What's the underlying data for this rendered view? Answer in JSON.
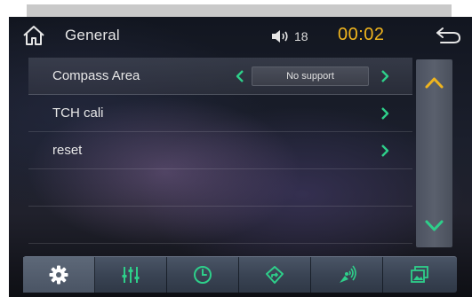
{
  "header": {
    "title": "General",
    "volume_level": "18",
    "time": "00:02"
  },
  "settings": {
    "items": [
      {
        "label": "Compass Area",
        "value": "No support"
      },
      {
        "label": "TCH cali"
      },
      {
        "label": "reset"
      }
    ]
  },
  "colors": {
    "accent": "#f0b51e",
    "text": "#e8e8e8",
    "chevron": "#2ecf8a"
  },
  "icons": {
    "home": "home-icon",
    "volume": "speaker-icon",
    "back": "back-arrow-icon",
    "scroll_up": "chevron-up-icon",
    "scroll_down": "chevron-down-icon",
    "nav": [
      "gear-icon",
      "equalizer-icon",
      "clock-icon",
      "navigation-icon",
      "satellite-icon",
      "wallpaper-icon"
    ]
  }
}
